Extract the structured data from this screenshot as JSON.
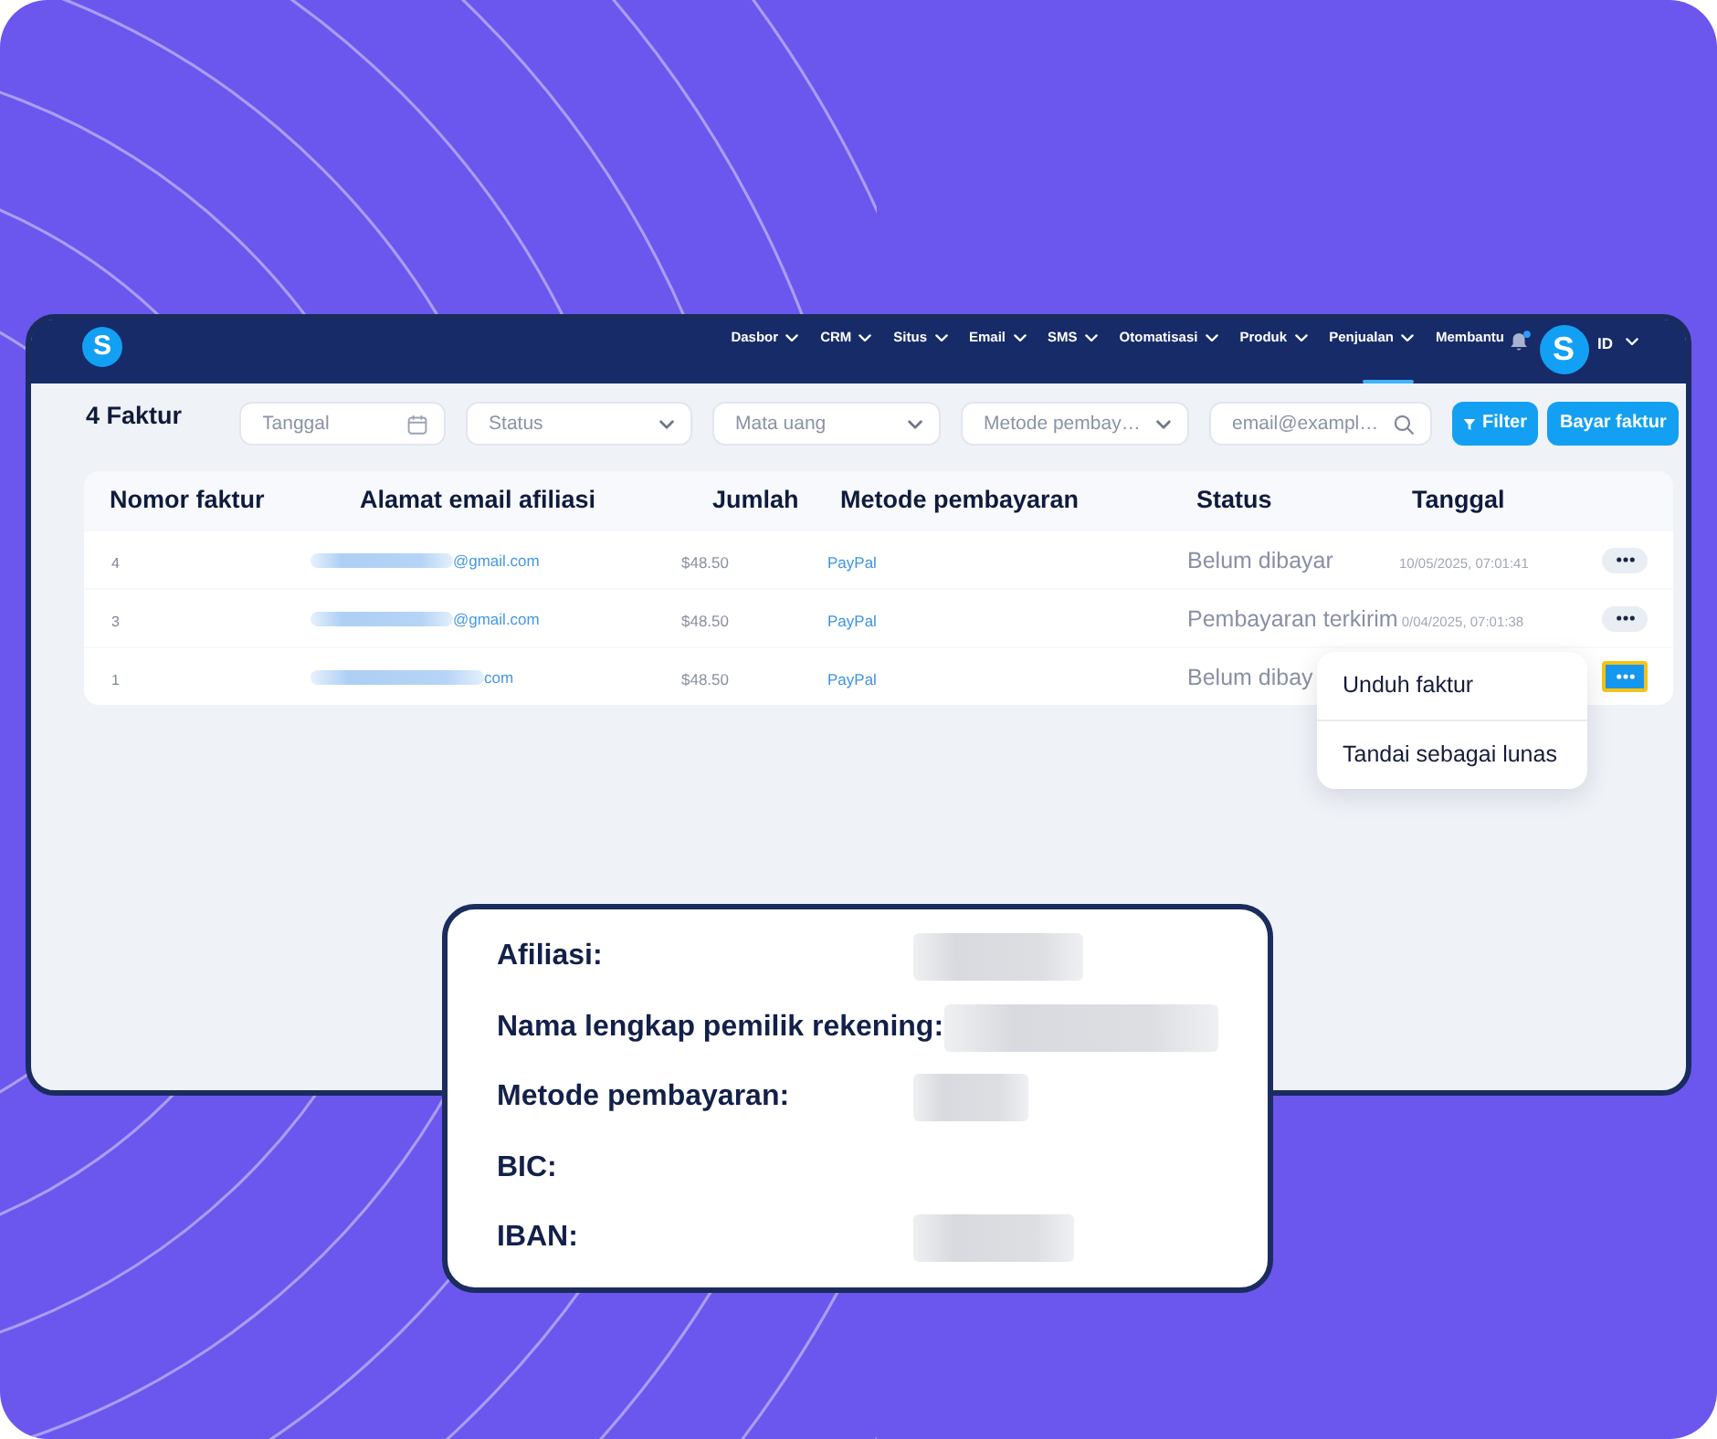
{
  "nav": {
    "logo": {
      "letter": "S"
    },
    "items": [
      {
        "label": "Dasbor",
        "dropdown": true,
        "selected": false
      },
      {
        "label": "CRM",
        "dropdown": true,
        "selected": false
      },
      {
        "label": "Situs",
        "dropdown": true,
        "selected": false
      },
      {
        "label": "Email",
        "dropdown": true,
        "selected": false
      },
      {
        "label": "SMS",
        "dropdown": true,
        "selected": false
      },
      {
        "label": "Otomatisasi",
        "dropdown": true,
        "selected": false
      },
      {
        "label": "Produk",
        "dropdown": true,
        "selected": false
      },
      {
        "label": "Penjualan",
        "dropdown": true,
        "selected": true
      },
      {
        "label": "Membantu",
        "dropdown": false,
        "selected": false
      }
    ],
    "notifications": {
      "unread": true
    },
    "avatar": {
      "initial": "S"
    },
    "language": {
      "label": "ID"
    }
  },
  "toolbar": {
    "title": "4 Faktur",
    "filters": [
      {
        "kind": "date",
        "placeholder": "Tanggal"
      },
      {
        "kind": "select",
        "placeholder": "Status"
      },
      {
        "kind": "select",
        "placeholder": "Mata uang"
      },
      {
        "kind": "select",
        "placeholder": "Metode pembay…"
      },
      {
        "kind": "search",
        "placeholder": "email@exampl…"
      }
    ],
    "buttons": [
      {
        "kind": "filter",
        "label": "Filter"
      },
      {
        "kind": "primary",
        "label": "Bayar faktur"
      }
    ]
  },
  "table": {
    "columns": [
      "Nomor faktur",
      "Alamat email afiliasi",
      "Jumlah",
      "Metode pembayaran",
      "Status",
      "Tanggal"
    ],
    "rows": [
      {
        "number": "4",
        "email_blurred": true,
        "email": "@gmail.com",
        "amount": "$48.50",
        "method": "PayPal",
        "status": "Belum dibayar",
        "date": "10/05/2025, 07:01:41",
        "menu_open": false
      },
      {
        "number": "3",
        "email_blurred": true,
        "email": "@gmail.com",
        "amount": "$48.50",
        "method": "PayPal",
        "status": "Pembayaran terkirim",
        "date": "0/04/2025, 07:01:38",
        "menu_open": false
      },
      {
        "number": "1",
        "email_blurred": true,
        "email": "com",
        "amount": "$48.50",
        "method": "PayPal",
        "status": "Belum dibay",
        "menu_open": true
      }
    ]
  },
  "row_menu": {
    "items": [
      "Unduh faktur",
      "Tandai sebagai lunas"
    ]
  },
  "detail_card": {
    "fields": [
      {
        "label": "Afiliasi:",
        "blurred": true
      },
      {
        "label": "Nama lengkap pemilik rekening:",
        "blurred": true
      },
      {
        "label": "Metode pembayaran:",
        "blurred": true
      },
      {
        "label": "BIC:",
        "blurred": false
      },
      {
        "label": "IBAN:",
        "blurred": true
      }
    ]
  }
}
